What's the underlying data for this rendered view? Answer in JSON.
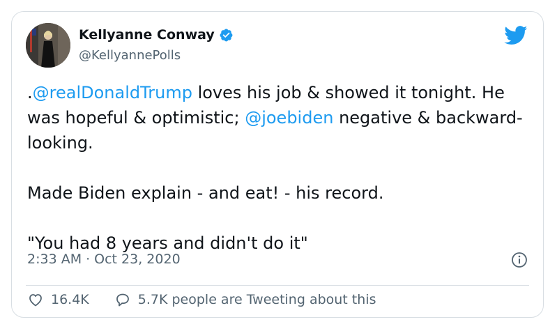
{
  "user": {
    "name": "Kellyanne Conway",
    "handle": "@KellyannePolls"
  },
  "tweet": {
    "paragraph1": {
      "prefix": ".",
      "mention1": "@realDonaldTrump",
      "text1": " loves his job & showed it tonight. He was hopeful & optimistic; ",
      "mention2": "@joebiden",
      "text2": " negative & backward-looking."
    },
    "paragraph2": "Made Biden explain - and eat! - his record.",
    "paragraph3": "\"You had 8 years and didn't do it\""
  },
  "meta": {
    "time": "2:33 AM",
    "separator": "·",
    "date": "Oct 23, 2020"
  },
  "actions": {
    "likes": "16.4K",
    "replies_label": "5.7K people are Tweeting about this"
  },
  "icons": {
    "verified": "verified-badge-icon",
    "bird": "twitter-bird-icon",
    "info": "info-icon",
    "heart": "heart-icon",
    "reply": "reply-icon"
  },
  "colors": {
    "accent": "#1d9bf0",
    "text": "#0f1419",
    "muted": "#536471",
    "border": "#d8dee3"
  }
}
